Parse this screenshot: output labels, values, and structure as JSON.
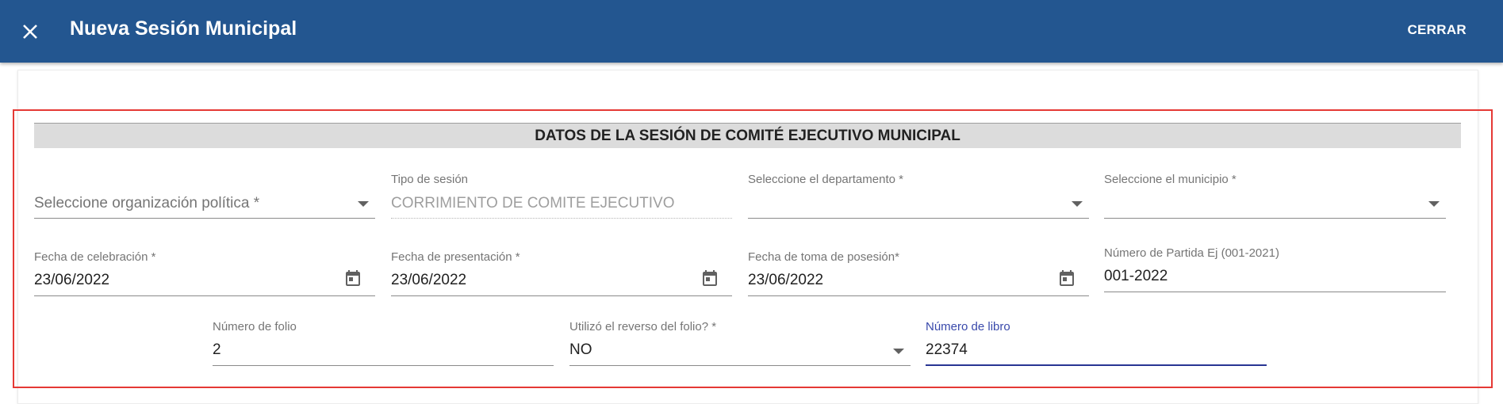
{
  "header": {
    "title": "Nueva Sesión Municipal",
    "close_label": "CERRAR",
    "background_color": "#235690"
  },
  "section": {
    "title": "DATOS DE LA SESIÓN DE COMITÉ EJECUTIVO MUNICIPAL"
  },
  "fields": {
    "organizacion": {
      "label": "",
      "placeholder": "Seleccione organización política *"
    },
    "tipo_sesion": {
      "label": "Tipo de sesión",
      "value": "CORRIMIENTO DE COMITE EJECUTIVO"
    },
    "departamento": {
      "label": "Seleccione el departamento *",
      "value": ""
    },
    "municipio": {
      "label": "Seleccione el municipio *",
      "value": ""
    },
    "fecha_celebracion": {
      "label": "Fecha de celebración *",
      "value": "23/06/2022"
    },
    "fecha_presentacion": {
      "label": "Fecha de presentación *",
      "value": "23/06/2022"
    },
    "fecha_toma": {
      "label": "Fecha de toma de posesión*",
      "value": "23/06/2022"
    },
    "numero_partida": {
      "label": "Número de Partida Ej (001-2021)",
      "value": "001-2022"
    },
    "numero_folio": {
      "label": "Número de folio",
      "value": "2"
    },
    "reverso_folio": {
      "label": "Utilizó el reverso del folio? *",
      "value": "NO"
    },
    "numero_libro": {
      "label": "Número de libro",
      "value": "22374"
    }
  },
  "colors": {
    "highlight": "#e53935",
    "focus": "#283593"
  }
}
